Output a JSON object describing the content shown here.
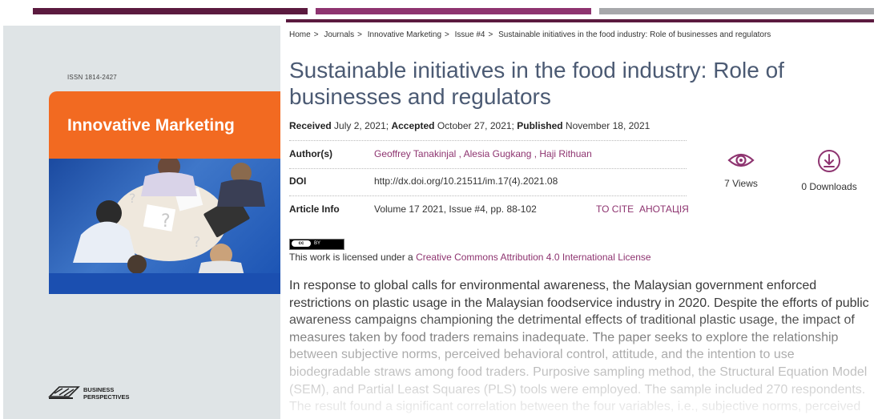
{
  "cover": {
    "issn": "ISSN 1814-2427",
    "title": "Innovative Marketing",
    "publisher_line1": "BUSINESS",
    "publisher_line2": "PERSPECTIVES"
  },
  "breadcrumb": [
    {
      "label": "Home"
    },
    {
      "label": "Journals"
    },
    {
      "label": "Innovative Marketing"
    },
    {
      "label": "Issue #4"
    },
    {
      "label": "Sustainable initiatives in the food industry: Role of businesses and regulators"
    }
  ],
  "breadcrumb_sep": ">",
  "article": {
    "title": "Sustainable initiatives in the food industry: Role of businesses and regulators",
    "received_label": "Received",
    "received_date": "July 2, 2021;",
    "accepted_label": "Accepted",
    "accepted_date": "October 27, 2021;",
    "published_label": "Published",
    "published_date": "November 18, 2021"
  },
  "info": {
    "authors_label": "Author(s)",
    "authors": [
      "Geoffrey Tanakinjal ,",
      "Alesia Gugkang ,",
      "Haji Rithuan"
    ],
    "doi_label": "DOI",
    "doi": "http://dx.doi.org/10.21511/im.17(4).2021.08",
    "article_info_label": "Article Info",
    "article_info": "Volume 17 2021, Issue #4, pp. 88-102",
    "cite_label": "TO CITE",
    "abstract_ua_label": "АНОТАЦІЯ"
  },
  "stats": {
    "views": "7 Views",
    "downloads": "0 Downloads",
    "icon_color": "#8e3470"
  },
  "license": {
    "badge_left": "cc",
    "badge_right": "BY",
    "prefix": "This work is licensed under a",
    "link": "Creative Commons Attribution 4.0 International License"
  },
  "abstract": "In response to global calls for environmental awareness, the Malaysian government enforced restrictions on plastic usage in the Malaysian foodservice industry in 2020. Despite the efforts of public awareness campaigns championing the detrimental effects of traditional plastic usage, the impact of measures taken by food traders remains inadequate. The paper seeks to explore the relationship between subjective norms, perceived behavioral control, attitude, and the intention to use biodegradable straws among food traders. Purposive sampling method, the Structural Equation Model (SEM), and Partial Least Squares (PLS) tools were employed. The sample included 270 respondents. The result found a significant correlation between the four variables, i.e., subjective norms, perceived",
  "colors": {
    "brand_dark": "#5b1a3f",
    "brand": "#8e3470",
    "gray": "#a7a8ab",
    "cover_orange": "#f26a21",
    "cover_blue": "#1b4fb0"
  }
}
